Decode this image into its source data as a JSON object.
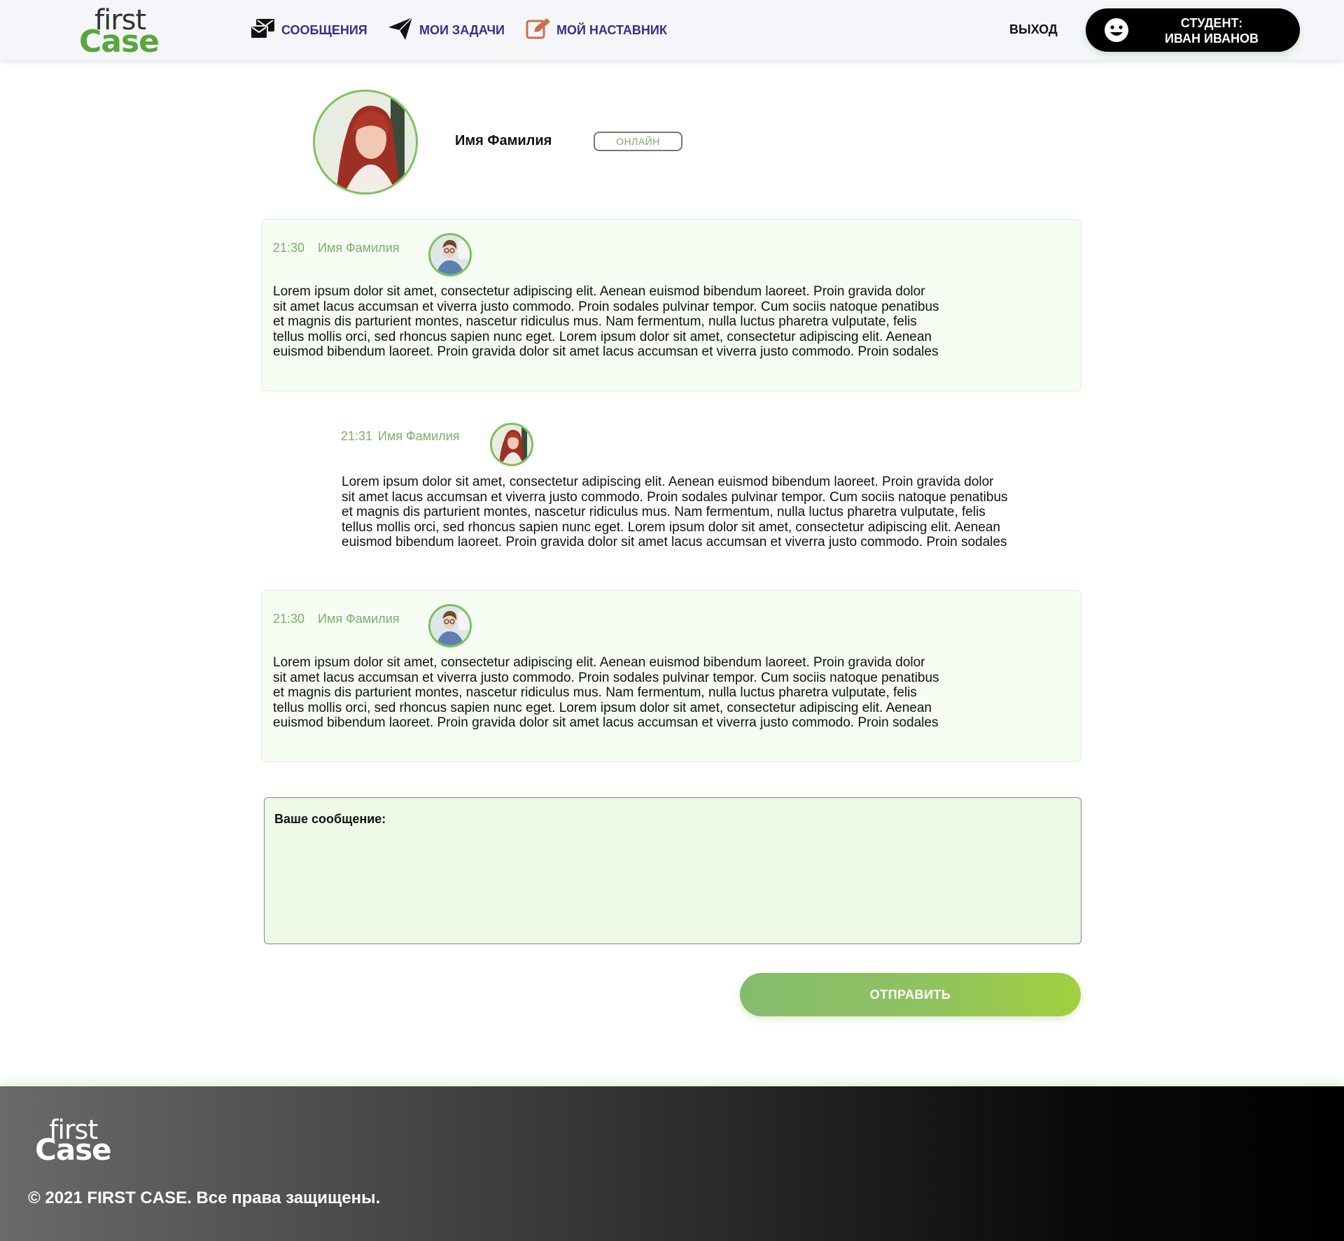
{
  "header": {
    "logo_top": "first",
    "logo_bottom": "Case",
    "nav": [
      {
        "label": "СООБЩЕНИЯ",
        "icon": "messages-icon"
      },
      {
        "label": "МОИ ЗАДАЧИ",
        "icon": "paper-plane-icon"
      },
      {
        "label": "МОЙ НАСТАВНИК",
        "icon": "edit-icon"
      }
    ],
    "logout_label": "ВЫХОД",
    "user": {
      "line1": "СТУДЕНТ:",
      "line2": "ИВАН ИВАНОВ",
      "icon": "smile-icon"
    }
  },
  "profile": {
    "name": "Имя Фамилия",
    "status": "ОНЛАЙН"
  },
  "messages": [
    {
      "time": "21:30",
      "author": "Имя Фамилия",
      "style": "card",
      "lines": [
        "Lorem ipsum dolor sit amet, consectetur adipiscing elit. Aenean euismod bibendum laoreet. Proin gravida dolor",
        "sit amet lacus accumsan et viverra justo commodo. Proin sodales pulvinar tempor. Cum sociis natoque penatibus",
        "et magnis dis parturient montes, nascetur ridiculus mus. Nam fermentum, nulla luctus pharetra vulputate, felis",
        "tellus mollis orci, sed rhoncus sapien nunc eget. Lorem ipsum dolor sit amet, consectetur adipiscing elit. Aenean",
        "euismod bibendum laoreet. Proin gravida dolor sit amet lacus accumsan et viverra justo commodo. Proin sodales"
      ]
    },
    {
      "time": "21:31",
      "author": "Имя Фамилия",
      "style": "plain",
      "lines": [
        "Lorem ipsum dolor sit amet, consectetur adipiscing elit. Aenean euismod bibendum laoreet. Proin gravida dolor",
        "sit amet lacus accumsan et viverra justo commodo. Proin sodales pulvinar tempor. Cum sociis natoque penatibus",
        "et magnis dis parturient montes, nascetur ridiculus mus. Nam fermentum, nulla luctus pharetra vulputate, felis",
        "tellus mollis orci, sed rhoncus sapien nunc eget. Lorem ipsum dolor sit amet, consectetur adipiscing elit. Aenean",
        "euismod bibendum laoreet. Proin gravida dolor sit amet lacus accumsan et viverra justo commodo. Proin sodales"
      ]
    },
    {
      "time": "21:30",
      "author": "Имя Фамилия",
      "style": "card",
      "lines": [
        "Lorem ipsum dolor sit amet, consectetur adipiscing elit. Aenean euismod bibendum laoreet. Proin gravida dolor",
        "sit amet lacus accumsan et viverra justo commodo. Proin sodales pulvinar tempor. Cum sociis natoque penatibus",
        "et magnis dis parturient montes, nascetur ridiculus mus. Nam fermentum, nulla luctus pharetra vulputate, felis",
        "tellus mollis orci, sed rhoncus sapien nunc eget. Lorem ipsum dolor sit amet, consectetur adipiscing elit. Aenean",
        "euismod bibendum laoreet. Proin gravida dolor sit amet lacus accumsan et viverra justo commodo. Proin sodales"
      ]
    }
  ],
  "composer": {
    "label": "Ваше сообщение:",
    "value": ""
  },
  "send_label": "ОТПРАВИТЬ",
  "footer": {
    "logo_top": "first",
    "logo_bottom": "Case",
    "copyright": "© 2021 FIRST CASE. Все права защищены."
  },
  "colors": {
    "brand_green": "#58a63c",
    "nav_purple": "#3d2b8a",
    "card_bg": "#f6fdf2",
    "composer_bg": "#eef9e8"
  }
}
